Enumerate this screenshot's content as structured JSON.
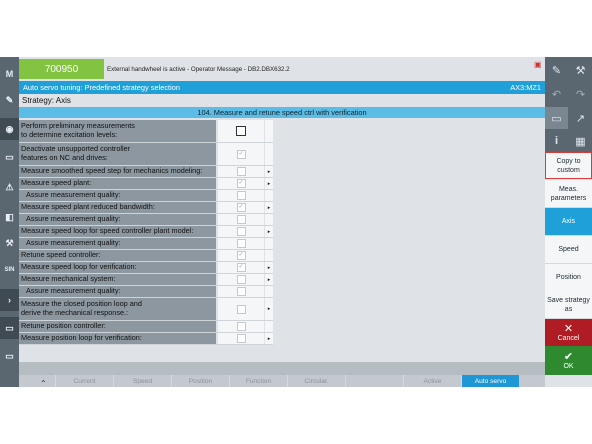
{
  "header": {
    "alarm_number": "700950",
    "alarm_text": "External handwheel is active - Operator Message -  DB2.DBX632.2",
    "title": "Auto servo tuning: Predefined strategy selection",
    "axis": "AX3:MZ1"
  },
  "strategy_label": "Strategy:  Axis",
  "section_title": "104. Measure and retune speed ctrl with verification",
  "rows": [
    {
      "lines": [
        "Perform preliminary measurements",
        "to determine excitation levels:"
      ],
      "indent": false,
      "check": "",
      "arrow": ""
    },
    {
      "lines": [
        "Deactivate unsupported controller",
        "features on NC and drives:"
      ],
      "indent": false,
      "check": "✓",
      "arrow": ""
    },
    {
      "lines": [
        "Measure smoothed speed step for mechanics modeling:"
      ],
      "indent": false,
      "check": "",
      "arrow": "▸"
    },
    {
      "lines": [
        "Measure speed plant:"
      ],
      "indent": false,
      "check": "✓",
      "arrow": "▸"
    },
    {
      "lines": [
        "Assure measurement quality:"
      ],
      "indent": true,
      "check": "",
      "arrow": ""
    },
    {
      "lines": [
        "Measure speed plant reduced bandwidth:"
      ],
      "indent": false,
      "check": "✓",
      "arrow": "▸"
    },
    {
      "lines": [
        "Assure measurement quality:"
      ],
      "indent": true,
      "check": "",
      "arrow": ""
    },
    {
      "lines": [
        "Measure speed loop for speed controller plant model:"
      ],
      "indent": false,
      "check": "",
      "arrow": "▸"
    },
    {
      "lines": [
        "Assure measurement quality:"
      ],
      "indent": true,
      "check": "",
      "arrow": ""
    },
    {
      "lines": [
        "Retune speed controller:"
      ],
      "indent": false,
      "check": "✓",
      "arrow": ""
    },
    {
      "lines": [
        "Measure speed loop for verification:"
      ],
      "indent": false,
      "check": "✓",
      "arrow": "▸"
    },
    {
      "lines": [
        "Measure mechanical system:"
      ],
      "indent": false,
      "check": "",
      "arrow": "▸"
    },
    {
      "lines": [
        "Assure measurement quality:"
      ],
      "indent": true,
      "check": "",
      "arrow": ""
    },
    {
      "lines": [
        "Measure the closed position loop and",
        "derive the mechanical response.:"
      ],
      "indent": false,
      "check": "",
      "arrow": "▸"
    },
    {
      "lines": [
        "Retune position controller:"
      ],
      "indent": false,
      "check": "",
      "arrow": ""
    },
    {
      "lines": [
        "Measure position loop for verification:"
      ],
      "indent": false,
      "check": "",
      "arrow": "▸"
    }
  ],
  "bottom_softkeys": [
    {
      "label": "Current",
      "active": false
    },
    {
      "label": "Speed",
      "active": false
    },
    {
      "label": "Position",
      "active": false
    },
    {
      "label": "Function",
      "active": false
    },
    {
      "label": "Circular.",
      "active": false
    },
    {
      "label": "",
      "active": false
    },
    {
      "label": "Active",
      "active": false
    },
    {
      "label": "Auto servo",
      "active": true
    }
  ],
  "right_softkeys": [
    {
      "label": "Copy to custom",
      "state": "outline"
    },
    {
      "label": "Meas. parameters",
      "state": ""
    },
    {
      "label": "Axis",
      "state": "sel"
    },
    {
      "label": "Speed",
      "state": ""
    },
    {
      "label": "Position",
      "state": ""
    },
    {
      "label": "Save strategy as",
      "state": ""
    }
  ],
  "cancel_label": "Cancel",
  "ok_label": "OK",
  "left_icons": [
    "machine-icon",
    "parameter-icon",
    "program-icon",
    "program-manager-icon",
    "diagnostics-icon",
    "setup-icon",
    "commissioning-icon",
    "sinumerik-icon",
    "more-icon",
    "window-icon",
    "window2-icon"
  ],
  "colors": {
    "accent": "#1fa0d8",
    "alarm": "#82c341",
    "cancel": "#b01c24",
    "ok": "#2f8a2f"
  }
}
